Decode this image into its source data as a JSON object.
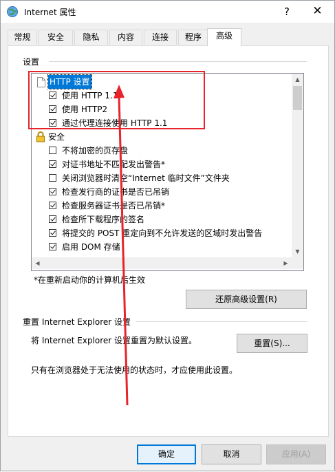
{
  "window": {
    "title": "Internet 属性",
    "help_label": "?",
    "close_label": "✕",
    "icon": "globe-icon"
  },
  "tabs": [
    {
      "label": "常规"
    },
    {
      "label": "安全"
    },
    {
      "label": "隐私"
    },
    {
      "label": "内容"
    },
    {
      "label": "连接"
    },
    {
      "label": "程序"
    },
    {
      "label": "高级",
      "active": true
    }
  ],
  "settings": {
    "group_label": "设置",
    "items": [
      {
        "type": "category",
        "label": "HTTP 设置",
        "icon": "page-icon",
        "selected": true
      },
      {
        "type": "checkbox",
        "label": "使用 HTTP 1.1",
        "checked": true
      },
      {
        "type": "checkbox",
        "label": "使用 HTTP2",
        "checked": true
      },
      {
        "type": "checkbox",
        "label": "通过代理连接使用 HTTP 1.1",
        "checked": true
      },
      {
        "type": "category",
        "label": "安全",
        "icon": "lock-icon"
      },
      {
        "type": "checkbox",
        "label": "不将加密的页存盘",
        "checked": false
      },
      {
        "type": "checkbox",
        "label": "对证书地址不匹配发出警告*",
        "checked": true
      },
      {
        "type": "checkbox",
        "label": "关闭浏览器时清空“Internet 临时文件”文件夹",
        "checked": false
      },
      {
        "type": "checkbox",
        "label": "检查发行商的证书是否已吊销",
        "checked": true
      },
      {
        "type": "checkbox",
        "label": "检查服务器证书是否已吊销*",
        "checked": true
      },
      {
        "type": "checkbox",
        "label": "检查所下载程序的签名",
        "checked": true
      },
      {
        "type": "checkbox",
        "label": "将提交的 POST 重定向到不允许发送的区域时发出警告",
        "checked": true
      },
      {
        "type": "checkbox",
        "label": "启用 DOM 存储",
        "checked": true
      }
    ],
    "restart_note": "*在重新启动你的计算机后生效",
    "restore_button": "还原高级设置(R)"
  },
  "reset": {
    "group_label": "重置 Internet Explorer 设置",
    "description": "将 Internet Explorer 设置重置为默认设置。",
    "reset_button": "重置(S)...",
    "note": "只有在浏览器处于无法使用的状态时，才应使用此设置。"
  },
  "footer": {
    "ok": "确定",
    "cancel": "取消",
    "apply": "应用(A)"
  },
  "annotation_color": "#e8232a"
}
